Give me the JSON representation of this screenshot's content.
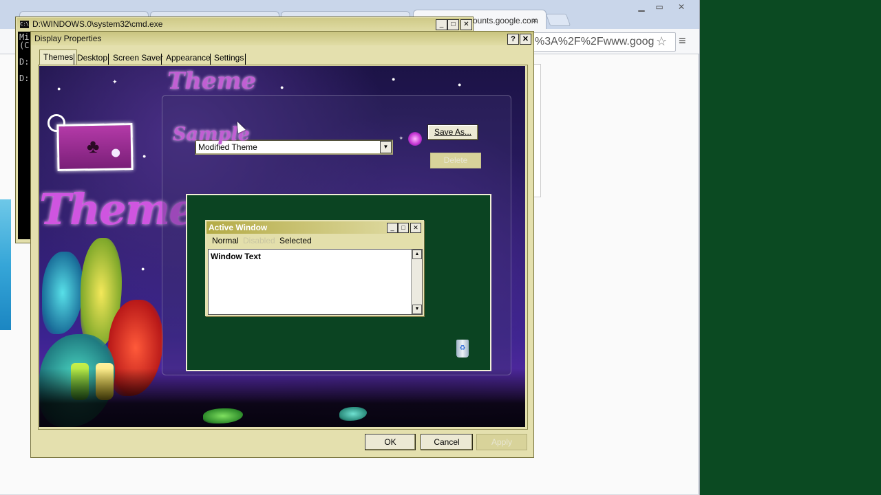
{
  "chrome": {
    "active_tab_title": "ounts.google.com",
    "tab_close": "×",
    "omnibox_text": "%3A%2F%2Fwww.goog",
    "minimize": "▁",
    "restore": "▭",
    "close": "✕"
  },
  "cmd": {
    "title": "D:\\WINDOWS.0\\system32\\cmd.exe",
    "icon_text": "C:\\",
    "lines": [
      "Mi",
      "(C",
      "",
      "D:",
      "",
      "D:"
    ],
    "minimize": "_",
    "maximize": "□",
    "close": "✕"
  },
  "dialog": {
    "title": "Display Properties",
    "help": "?",
    "close": "✕",
    "tabs": [
      "Themes",
      "Desktop",
      "Screen Saver",
      "Appearance",
      "Settings"
    ],
    "theme_heading": "Theme",
    "sample_heading": "Sample",
    "wallpaper_logo": "Themes",
    "theme_select_value": "Modified Theme",
    "save_as_label": "Save As...",
    "delete_label": "Delete",
    "sample": {
      "window_title": "Active Window",
      "menu": [
        "Normal",
        "Disabled",
        "Selected"
      ],
      "window_text": "Window Text"
    },
    "ok_label": "OK",
    "cancel_label": "Cancel",
    "apply_label": "Apply"
  }
}
